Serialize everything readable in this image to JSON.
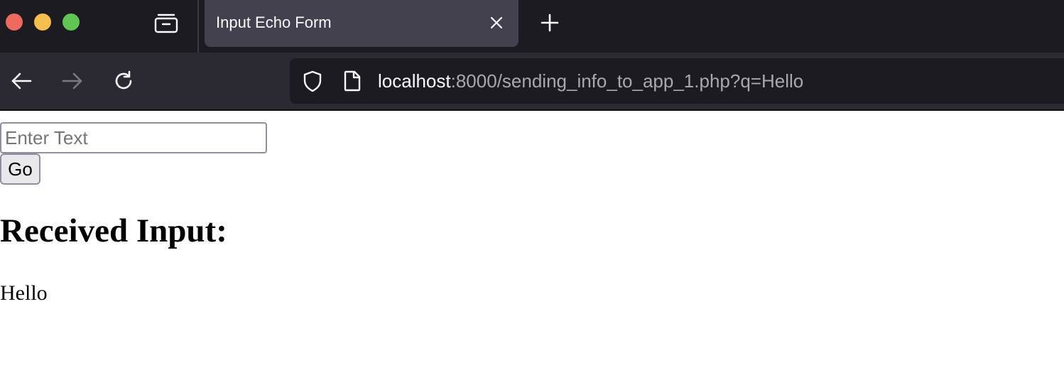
{
  "browser": {
    "tab": {
      "title": "Input Echo Form"
    },
    "address_bar": {
      "host": "localhost",
      "path": ":8000/sending_info_to_app_1.php?q=Hello"
    },
    "icons": {
      "window_close": "close-window-icon",
      "window_minimize": "minimize-window-icon",
      "window_maximize": "maximize-window-icon",
      "tab_overview": "tab-overview-icon",
      "tab_close": "close-icon",
      "new_tab": "plus-icon",
      "back": "arrow-left-icon",
      "forward": "arrow-right-icon",
      "reload": "reload-icon",
      "tracking_protection": "shield-icon",
      "page_info": "page-icon"
    },
    "colors": {
      "close": "#ec6a5e",
      "minimize": "#f4bf4f",
      "maximize": "#61c554",
      "chrome_dark": "#1c1b22",
      "chrome_toolbar": "#2b2a33",
      "tab_active": "#42414d"
    }
  },
  "page": {
    "form": {
      "input_value": "",
      "input_placeholder": "Enter Text",
      "submit_label": "Go"
    },
    "heading": "Received Input:",
    "received_text": "Hello"
  }
}
